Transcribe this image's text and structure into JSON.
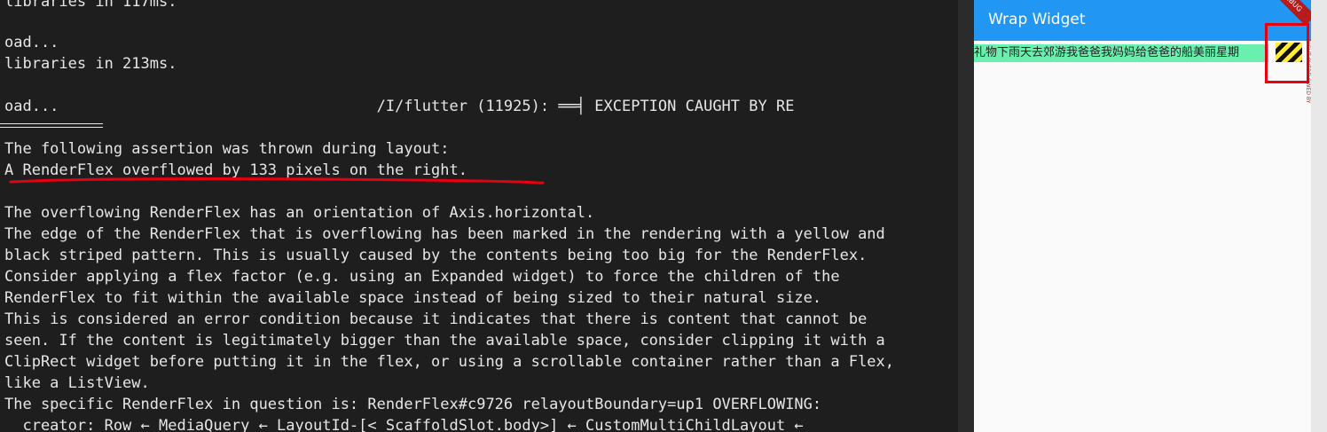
{
  "console": {
    "lines": [
      "libraries in 117ms.",
      "",
      "oad...",
      "libraries in 213ms.",
      "",
      "oad...                                   /I/flutter (11925): ══╡ EXCEPTION CAUGHT BY RE",
      "",
      "The following assertion was thrown during layout:",
      "A RenderFlex overflowed by 133 pixels on the right.",
      "",
      "The overflowing RenderFlex has an orientation of Axis.horizontal.",
      "The edge of the RenderFlex that is overflowing has been marked in the rendering with a yellow and",
      "black striped pattern. This is usually caused by the contents being too big for the RenderFlex.",
      "Consider applying a flex factor (e.g. using an Expanded widget) to force the children of the",
      "RenderFlex to fit within the available space instead of being sized to their natural size.",
      "This is considered an error condition because it indicates that there is content that cannot be",
      "seen. If the content is legitimately bigger than the available space, consider clipping it with a",
      "ClipRect widget before putting it in the flex, or using a scrollable container rather than a Flex,",
      "like a ListView.",
      "The specific RenderFlex in question is: RenderFlex#c9726 relayoutBoundary=up1 OVERFLOWING:",
      "  creator: Row ← MediaQuery ← LayoutId-[<_ScaffoldSlot.body>] ← CustomMultiChildLayout ←"
    ]
  },
  "emulator": {
    "app_title": "Wrap Widget",
    "debug_banner": "DEBUG",
    "row_text": "礼物下雨天去郊游我爸爸我妈妈给爸爸的船美丽星期",
    "overflow_label": "RIGHT OVERFLOWED BY",
    "colors": {
      "appbar": "#2196f3",
      "row_background": "#69f0ae",
      "stripe_yellow": "#ffeb3b",
      "annotation_red": "#e60012"
    }
  }
}
